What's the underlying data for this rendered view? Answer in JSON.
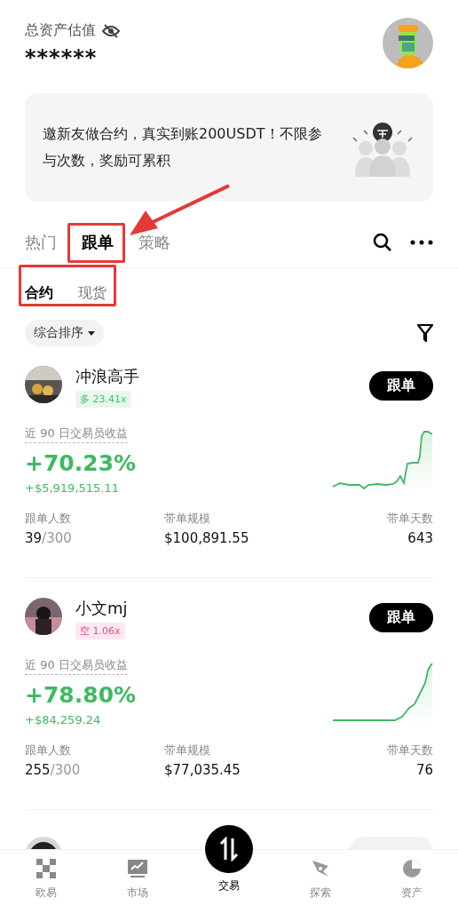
{
  "header": {
    "label": "总资产估值",
    "value": "******"
  },
  "banner": {
    "text": "邀新友做合约，真实到账200USDT！不限参与次数，奖励可累积"
  },
  "tabs": [
    {
      "label": "热门",
      "selected": false
    },
    {
      "label": "跟单",
      "selected": true
    },
    {
      "label": "策略",
      "selected": false
    }
  ],
  "sub_tabs": [
    {
      "label": "合约",
      "selected": true
    },
    {
      "label": "现货",
      "selected": false
    }
  ],
  "sort": {
    "label": "综合排序"
  },
  "traders": [
    {
      "name": "冲浪高手",
      "kind": "long",
      "side_label": "多 23.41x",
      "follow_button": "跟单",
      "pnl_label": "近 90 日交易员收益",
      "roi": "+70.23%",
      "pnl": "+$5,919,515.11",
      "stats": [
        {
          "label": "跟单人数",
          "value": "39",
          "limit": "/300"
        },
        {
          "label": "带单规模",
          "value": "$100,891.55"
        },
        {
          "label": "带单天数",
          "value": "643"
        }
      ]
    },
    {
      "name": "小文mj",
      "kind": "short",
      "side_label": "空 1.06x",
      "follow_button": "跟单",
      "pnl_label": "近 90 日交易员收益",
      "roi": "+78.80%",
      "pnl": "+$84,259.24",
      "stats": [
        {
          "label": "跟单人数",
          "value": "255",
          "limit": "/300"
        },
        {
          "label": "带单规模",
          "value": "$77,035.45"
        },
        {
          "label": "带单天数",
          "value": "76"
        }
      ]
    }
  ],
  "nav": [
    {
      "label": "欧易",
      "kind": "tab",
      "selected": false
    },
    {
      "label": "市场",
      "kind": "tab",
      "selected": false
    },
    {
      "label": "交易",
      "kind": "fab",
      "selected": true
    },
    {
      "label": "探索",
      "kind": "tab",
      "selected": false
    },
    {
      "label": "资产",
      "kind": "tab",
      "selected": false
    }
  ]
}
